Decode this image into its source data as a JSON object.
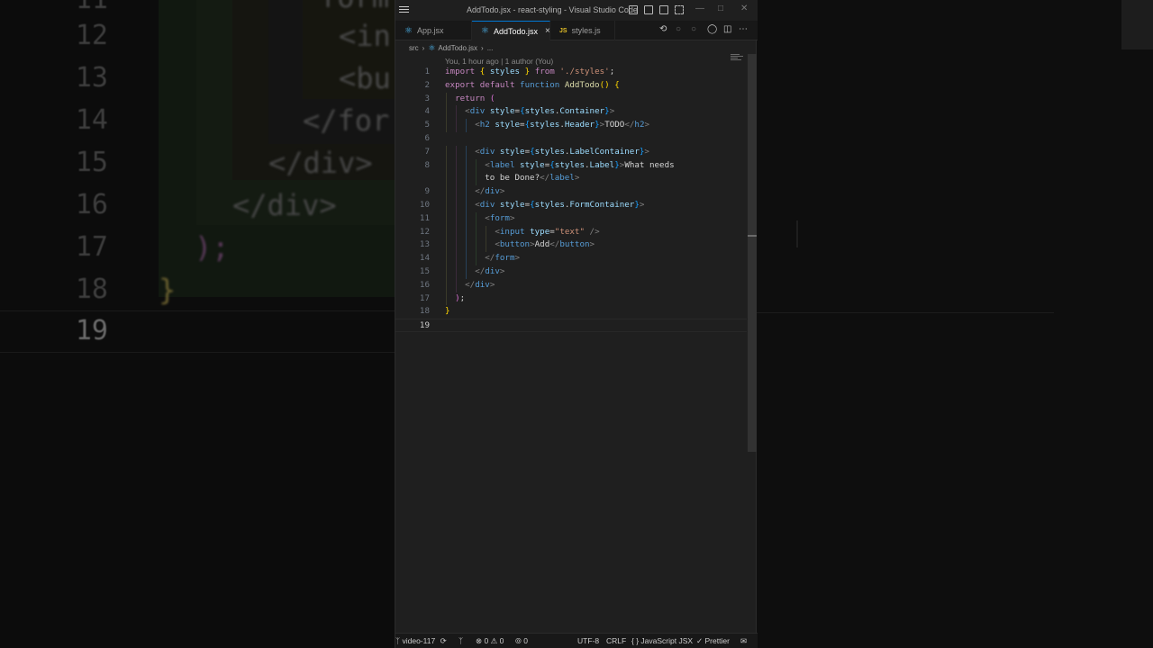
{
  "background": {
    "line_numbers": [
      "11",
      "12",
      "13",
      "14",
      "15",
      "16",
      "17",
      "18",
      "19"
    ],
    "code_fragments": [
      "form",
      "<in",
      "<bu",
      "</for",
      "</div>",
      "</div>",
      ");",
      "}"
    ]
  },
  "window": {
    "title": "AddTodo.jsx - react-styling - Visual Studio Code"
  },
  "tabs": [
    {
      "label": "App.jsx",
      "icon": "react-icon",
      "active": false
    },
    {
      "label": "AddTodo.jsx",
      "icon": "react-icon",
      "active": true
    },
    {
      "label": "styles.js",
      "icon": "js-icon",
      "active": false
    }
  ],
  "tab_close_glyph": "×",
  "js_badge": "JS",
  "breadcrumb": {
    "folder": "src",
    "file": "AddTodo.jsx",
    "more": "..."
  },
  "blame": "You, 1 hour ago | 1 author (You)",
  "editor": {
    "current_line": 19,
    "lines": [
      {
        "n": "1",
        "parts": [
          [
            "kw",
            "import"
          ],
          [
            "tx",
            " "
          ],
          [
            "br1",
            "{"
          ],
          [
            "tx",
            " "
          ],
          [
            "vr",
            "styles"
          ],
          [
            "tx",
            " "
          ],
          [
            "br1",
            "}"
          ],
          [
            "tx",
            " "
          ],
          [
            "kw",
            "from"
          ],
          [
            "tx",
            " "
          ],
          [
            "st",
            "'./styles'"
          ],
          [
            "tx",
            ";"
          ]
        ]
      },
      {
        "n": "2",
        "parts": [
          [
            "kw",
            "export"
          ],
          [
            "tx",
            " "
          ],
          [
            "kw",
            "default"
          ],
          [
            "tx",
            " "
          ],
          [
            "kb",
            "function"
          ],
          [
            "tx",
            " "
          ],
          [
            "fn",
            "AddTodo"
          ],
          [
            "br1",
            "()"
          ],
          [
            "tx",
            " "
          ],
          [
            "br1",
            "{"
          ]
        ]
      },
      {
        "n": "3",
        "parts": [
          [
            "tx",
            "  "
          ],
          [
            "kw",
            "return"
          ],
          [
            "tx",
            " "
          ],
          [
            "br2",
            "("
          ]
        ]
      },
      {
        "n": "4",
        "parts": [
          [
            "tx",
            "    "
          ],
          [
            "pn",
            "<"
          ],
          [
            "tg",
            "div"
          ],
          [
            "tx",
            " "
          ],
          [
            "vr",
            "style"
          ],
          [
            "tx",
            "="
          ],
          [
            "br3",
            "{"
          ],
          [
            "vr",
            "styles"
          ],
          [
            "tx",
            "."
          ],
          [
            "vr",
            "Container"
          ],
          [
            "br3",
            "}"
          ],
          [
            "pn",
            ">"
          ]
        ]
      },
      {
        "n": "5",
        "parts": [
          [
            "tx",
            "      "
          ],
          [
            "pn",
            "<"
          ],
          [
            "tg",
            "h2"
          ],
          [
            "tx",
            " "
          ],
          [
            "vr",
            "style"
          ],
          [
            "tx",
            "="
          ],
          [
            "br3",
            "{"
          ],
          [
            "vr",
            "styles"
          ],
          [
            "tx",
            "."
          ],
          [
            "vr",
            "Header"
          ],
          [
            "br3",
            "}"
          ],
          [
            "pn",
            ">"
          ],
          [
            "tx",
            "TODO"
          ],
          [
            "pn",
            "</"
          ],
          [
            "tg",
            "h2"
          ],
          [
            "pn",
            ">"
          ]
        ]
      },
      {
        "n": "6",
        "parts": []
      },
      {
        "n": "7",
        "parts": [
          [
            "tx",
            "      "
          ],
          [
            "pn",
            "<"
          ],
          [
            "tg",
            "div"
          ],
          [
            "tx",
            " "
          ],
          [
            "vr",
            "style"
          ],
          [
            "tx",
            "="
          ],
          [
            "br3",
            "{"
          ],
          [
            "vr",
            "styles"
          ],
          [
            "tx",
            "."
          ],
          [
            "vr",
            "LabelContainer"
          ],
          [
            "br3",
            "}"
          ],
          [
            "pn",
            ">"
          ]
        ]
      },
      {
        "n": "8",
        "parts": [
          [
            "tx",
            "        "
          ],
          [
            "pn",
            "<"
          ],
          [
            "tg",
            "label"
          ],
          [
            "tx",
            " "
          ],
          [
            "vr",
            "style"
          ],
          [
            "tx",
            "="
          ],
          [
            "br3",
            "{"
          ],
          [
            "vr",
            "styles"
          ],
          [
            "tx",
            "."
          ],
          [
            "vr",
            "Label"
          ],
          [
            "br3",
            "}"
          ],
          [
            "pn",
            ">"
          ],
          [
            "tx",
            "What needs"
          ]
        ]
      },
      {
        "n": "",
        "parts": [
          [
            "tx",
            "        to be Done?"
          ],
          [
            "pn",
            "</"
          ],
          [
            "tg",
            "label"
          ],
          [
            "pn",
            ">"
          ]
        ]
      },
      {
        "n": "9",
        "parts": [
          [
            "tx",
            "      "
          ],
          [
            "pn",
            "</"
          ],
          [
            "tg",
            "div"
          ],
          [
            "pn",
            ">"
          ]
        ]
      },
      {
        "n": "10",
        "parts": [
          [
            "tx",
            "      "
          ],
          [
            "pn",
            "<"
          ],
          [
            "tg",
            "div"
          ],
          [
            "tx",
            " "
          ],
          [
            "vr",
            "style"
          ],
          [
            "tx",
            "="
          ],
          [
            "br3",
            "{"
          ],
          [
            "vr",
            "styles"
          ],
          [
            "tx",
            "."
          ],
          [
            "vr",
            "FormContainer"
          ],
          [
            "br3",
            "}"
          ],
          [
            "pn",
            ">"
          ]
        ]
      },
      {
        "n": "11",
        "parts": [
          [
            "tx",
            "        "
          ],
          [
            "pn",
            "<"
          ],
          [
            "tg",
            "form"
          ],
          [
            "pn",
            ">"
          ]
        ]
      },
      {
        "n": "12",
        "parts": [
          [
            "tx",
            "          "
          ],
          [
            "pn",
            "<"
          ],
          [
            "tg",
            "input"
          ],
          [
            "tx",
            " "
          ],
          [
            "vr",
            "type"
          ],
          [
            "tx",
            "="
          ],
          [
            "st",
            "\"text\""
          ],
          [
            "tx",
            " "
          ],
          [
            "pn",
            "/>"
          ]
        ]
      },
      {
        "n": "13",
        "parts": [
          [
            "tx",
            "          "
          ],
          [
            "pn",
            "<"
          ],
          [
            "tg",
            "button"
          ],
          [
            "pn",
            ">"
          ],
          [
            "tx",
            "Add"
          ],
          [
            "pn",
            "</"
          ],
          [
            "tg",
            "button"
          ],
          [
            "pn",
            ">"
          ]
        ]
      },
      {
        "n": "14",
        "parts": [
          [
            "tx",
            "        "
          ],
          [
            "pn",
            "</"
          ],
          [
            "tg",
            "form"
          ],
          [
            "pn",
            ">"
          ]
        ]
      },
      {
        "n": "15",
        "parts": [
          [
            "tx",
            "      "
          ],
          [
            "pn",
            "</"
          ],
          [
            "tg",
            "div"
          ],
          [
            "pn",
            ">"
          ]
        ]
      },
      {
        "n": "16",
        "parts": [
          [
            "tx",
            "    "
          ],
          [
            "pn",
            "</"
          ],
          [
            "tg",
            "div"
          ],
          [
            "pn",
            ">"
          ]
        ]
      },
      {
        "n": "17",
        "parts": [
          [
            "tx",
            "  "
          ],
          [
            "br2",
            ")"
          ],
          [
            "tx",
            ";"
          ]
        ]
      },
      {
        "n": "18",
        "parts": [
          [
            "br1",
            "}"
          ]
        ]
      },
      {
        "n": "19",
        "parts": []
      }
    ]
  },
  "statusbar": {
    "branch": "video-117",
    "errors": "0",
    "warnings": "0",
    "ports": "0",
    "encoding": "UTF-8",
    "eol": "CRLF",
    "language": "JavaScript JSX",
    "formatter": "Prettier"
  },
  "colors": {
    "editor_bg": "#1f1f1f",
    "keyword": "#c586c0",
    "function": "#dcdcaa",
    "string": "#ce9178",
    "variable": "#9cdcfe",
    "tag": "#569cd6",
    "accent": "#0078d4"
  }
}
